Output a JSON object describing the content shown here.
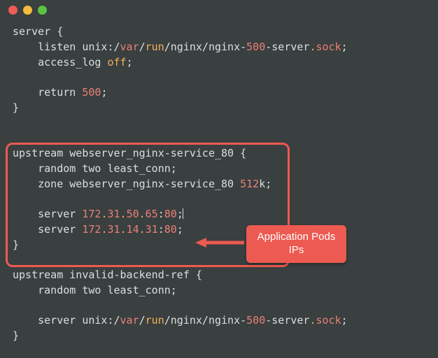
{
  "title_bar": {
    "buttons": [
      "close",
      "minimize",
      "zoom"
    ]
  },
  "colors": {
    "bg": "#3a3f3f",
    "text": "#d8e0df",
    "keyword_orange": "#f3b45b",
    "keyword_red": "#e98079",
    "highlight": "#ed5a51"
  },
  "code": {
    "block1_line1a": "server {",
    "block1_line2a": "    listen unix:/",
    "block1_line2_var": "var",
    "block1_line2b": "/",
    "block1_line2_run": "run",
    "block1_line2c": "/nginx/nginx-",
    "block1_line2_num": "500",
    "block1_line2d": "-server",
    "block1_line2_dot": ".",
    "block1_line2_sock": "sock",
    "block1_line2e": ";",
    "block1_line3a": "    access_log ",
    "block1_line3_off": "off",
    "block1_line3b": ";",
    "block1_line5a": "    return ",
    "block1_line5_num": "500",
    "block1_line5b": ";",
    "block1_line6": "}",
    "block2_line1": "upstream webserver_nginx-service_80 {",
    "block2_line2": "    random two least_conn;",
    "block2_line3a": "    zone webserver_nginx-service_80 ",
    "block2_line3_num": "512",
    "block2_line3b": "k;",
    "block2_line5a": "    server ",
    "block2_line5_n1": "172",
    "block2_line5_d": ".",
    "block2_line5_n2": "31",
    "block2_line5_n3": "50",
    "block2_line5_n4": "65",
    "block2_line5b": ":",
    "block2_line5_port": "80",
    "block2_line5c": ";",
    "block2_line6a": "    server ",
    "block2_line6_n1": "172",
    "block2_line6_n2": "31",
    "block2_line6_n3": "14",
    "block2_line6_n4": "31",
    "block2_line6b": ":",
    "block2_line6_port": "80",
    "block2_line6c": ";",
    "block2_line7": "}",
    "block3_line1": "upstream invalid-backend-ref {",
    "block3_line2": "    random two least_conn;",
    "block3_line4a": "    server unix:/",
    "block3_line4_var": "var",
    "block3_line4b": "/",
    "block3_line4_run": "run",
    "block3_line4c": "/nginx/nginx-",
    "block3_line4_num": "500",
    "block3_line4d": "-server",
    "block3_line4_dot": ".",
    "block3_line4_sock": "sock",
    "block3_line4e": ";",
    "block3_line5": "}"
  },
  "callout": {
    "text": "Application Pods\nIPs"
  }
}
